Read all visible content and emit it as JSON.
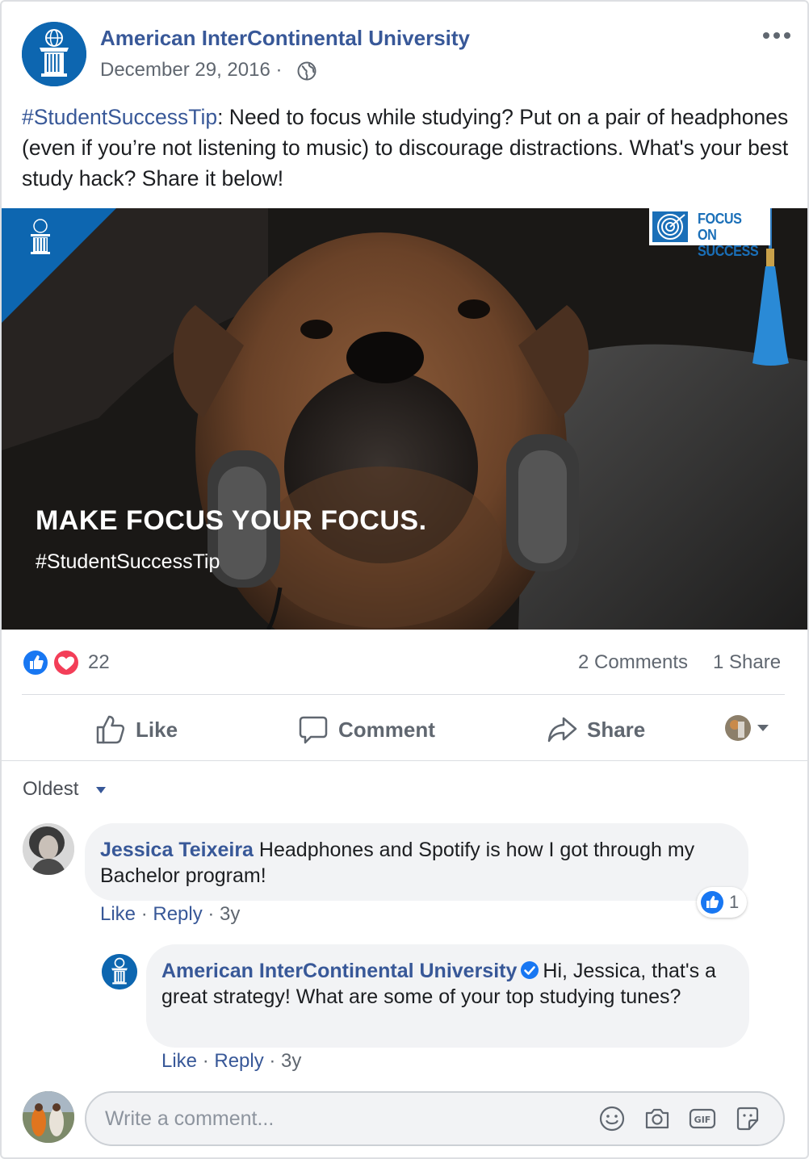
{
  "post": {
    "page_name": "American InterContinental University",
    "date": "December 29, 2016 ·",
    "text_hashtag": "#StudentSuccessTip",
    "text_body": ": Need to focus while studying? Put on a pair of headphones (even if you’re not listening to music) to discourage distractions. What's your best study hack? Share it below!",
    "image": {
      "headline": "MAKE FOCUS YOUR FOCUS.",
      "hashtag": "#StudentSuccessTip",
      "badge_line1": "FOCUS ON",
      "badge_line2": "SUCCESS"
    }
  },
  "reactions": {
    "count": "22",
    "comments": "2 Comments",
    "shares": "1 Share",
    "icons": [
      "like-icon",
      "love-icon"
    ],
    "like_color": "#1877f2",
    "love_color": "#f33e58"
  },
  "actions": {
    "like": "Like",
    "comment": "Comment",
    "share": "Share"
  },
  "comments": {
    "sort": "Oldest",
    "items": [
      {
        "author": "Jessica Teixeira",
        "text": "Headphones and Spotify is how I got through my Bachelor program!",
        "like": "Like",
        "reply": "Reply",
        "age": "3y",
        "reaction_count": "1"
      },
      {
        "author": "American InterContinental University",
        "verified": true,
        "text": "Hi, Jessica, that's a great strategy! What are some of your top studying tunes?",
        "like": "Like",
        "reply": "Reply",
        "age": "3y"
      }
    ]
  },
  "composer": {
    "placeholder": "Write a comment...",
    "icons": [
      "emoji-icon",
      "camera-icon",
      "gif-icon",
      "sticker-icon"
    ]
  },
  "colors": {
    "brand_blue": "#385898",
    "aiu_blue": "#0d66b0",
    "text_grey": "#606770"
  }
}
